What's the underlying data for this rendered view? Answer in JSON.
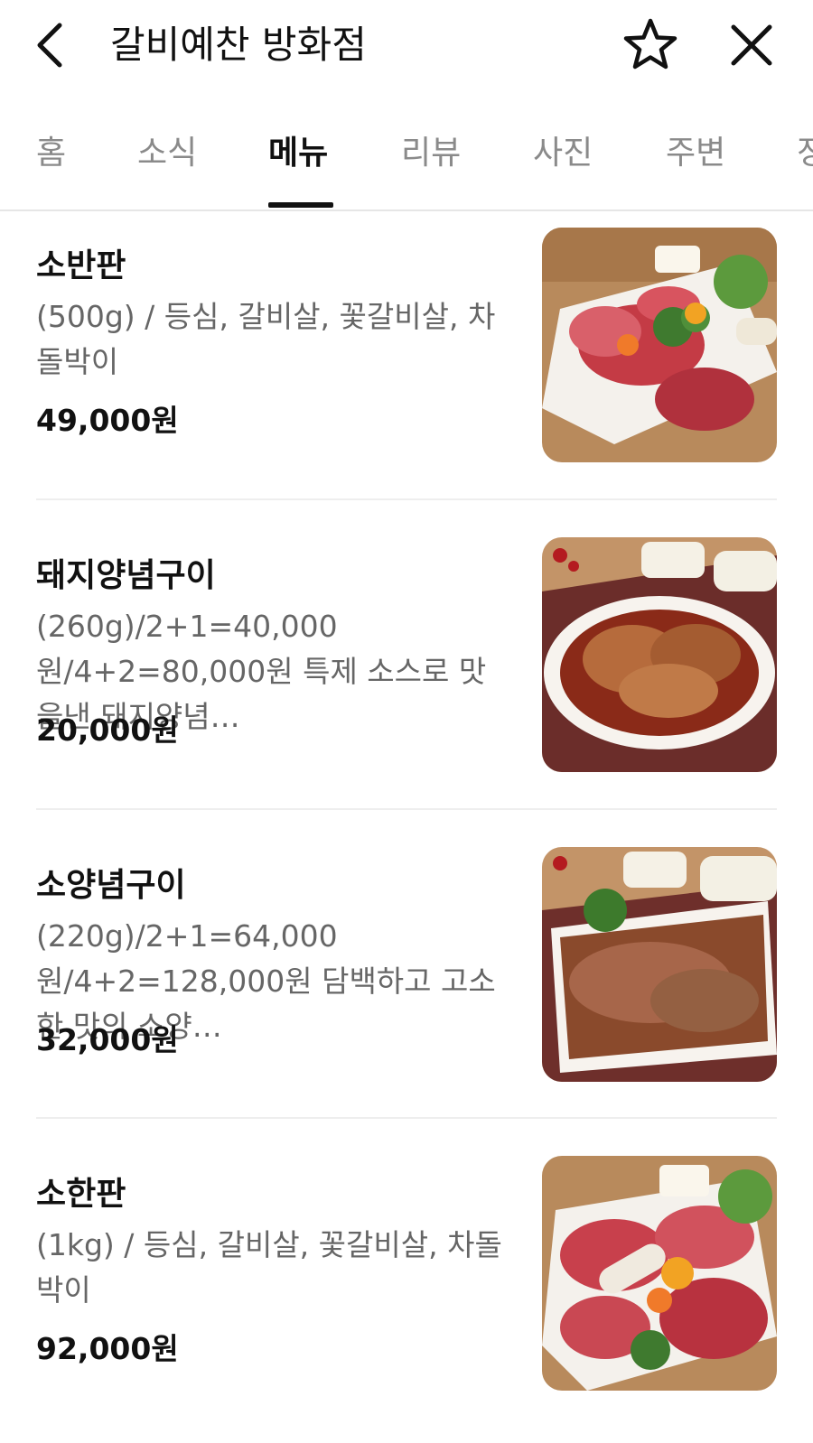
{
  "header": {
    "title": "갈비예찬 방화점",
    "back_icon": "chevron-left-icon",
    "favorite_icon": "star-outline-icon",
    "close_icon": "close-icon"
  },
  "tabs": [
    {
      "label": "홈",
      "active": false
    },
    {
      "label": "소식",
      "active": false
    },
    {
      "label": "메뉴",
      "active": true
    },
    {
      "label": "리뷰",
      "active": false
    },
    {
      "label": "사진",
      "active": false
    },
    {
      "label": "주변",
      "active": false
    },
    {
      "label": "정",
      "active": false
    }
  ],
  "menu": [
    {
      "name": "소반판",
      "description": "(500g) / 등심, 갈비살, 꽃갈비살, 차돌박이",
      "price": "49,000원"
    },
    {
      "name": "돼지양념구이",
      "description": "(260g)/2+1=40,000원/4+2=80,000원 특제 소스로 맛을낸 돼지양념…",
      "price": "20,000원"
    },
    {
      "name": "소양념구이",
      "description": "(220g)/2+1=64,000원/4+2=128,000원 담백하고 고소한 맛의 소양…",
      "price": "32,000원"
    },
    {
      "name": "소한판",
      "description": "(1kg) / 등심, 갈비살, 꽃갈비살, 차돌박이",
      "price": "92,000원"
    }
  ],
  "colors": {
    "active_tab": "#111111",
    "inactive_tab": "#8a8a8a",
    "description": "#666666",
    "divider": "#eeeeee"
  }
}
